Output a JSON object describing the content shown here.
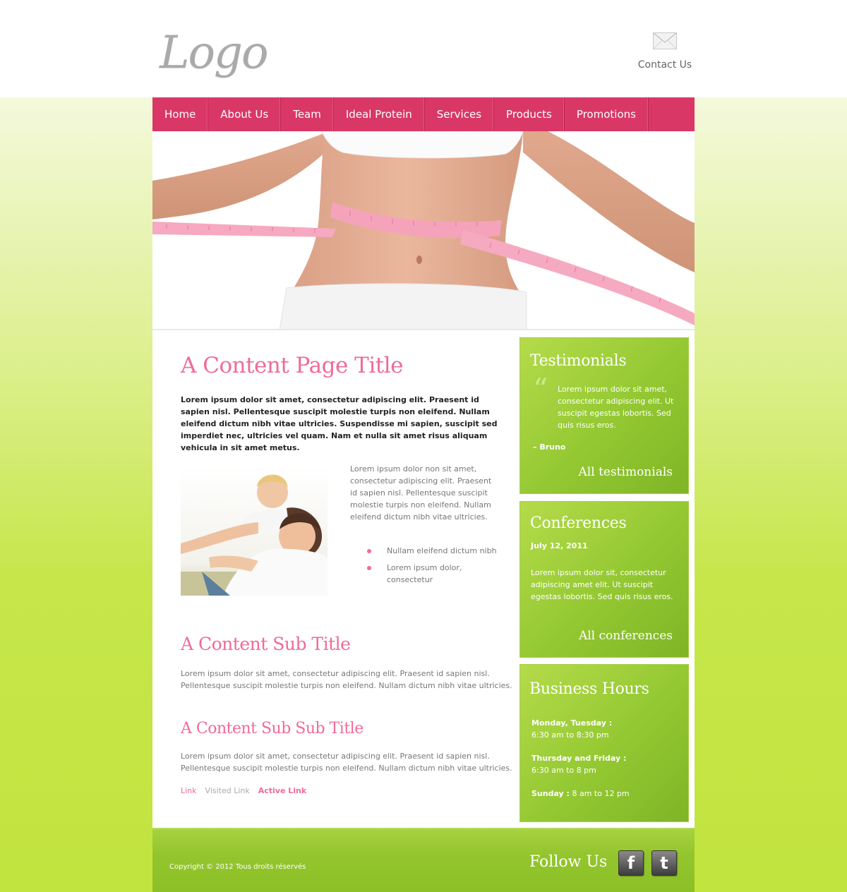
{
  "header": {
    "logo_text": "Logo",
    "contact_label": "Contact Us",
    "envelope_icon": "envelope-icon"
  },
  "nav": {
    "items": [
      {
        "label": "Home"
      },
      {
        "label": "About Us"
      },
      {
        "label": "Team"
      },
      {
        "label": "Ideal Protein"
      },
      {
        "label": "Services"
      },
      {
        "label": "Products"
      },
      {
        "label": "Promotions"
      }
    ]
  },
  "main": {
    "title": "A Content Page Title",
    "intro": "Lorem ipsum dolor sit amet, consectetur adipiscing elit. Praesent id sapien nisl. Pellentesque suscipit molestie turpis non eleifend. Nullam eleifend dictum nibh vitae ultricies. Suspendisse mi sapien, suscipit sed imperdiet nec, ultricies vel quam. Nam et nulla sit amet risus aliquam vehicula in sit amet metus.",
    "side_text": "Lorem ipsum dolor non sit amet, consectetur adipiscing elit. Praesent id sapien nisl. Pellentesque suscipit molestie turpis non eleifend. Nullam eleifend dictum nibh vitae ultricies.",
    "bullets": [
      "Nullam eleifend dictum nibh",
      "Lorem ipsum dolor, consectetur"
    ],
    "sub_title": "A Content Sub Title",
    "sub_text": "Lorem ipsum dolor sit amet, consectetur adipiscing elit. Praesent id sapien nisl. Pellentesque suscipit molestie turpis non eleifend. Nullam dictum nibh vitae ultricies.",
    "subsub_title": "A Content Sub Sub Title",
    "subsub_text": "Lorem ipsum dolor sit amet, consectetur adipiscing elit. Praesent id sapien nisl. Pellentesque suscipit molestie turpis non eleifend. Nullam dictum nibh vitae ultricies.",
    "links": {
      "link": "Link",
      "visited": "Visited Link",
      "active": "Active Link"
    }
  },
  "sidebar": {
    "testimonials": {
      "title": "Testimonials",
      "quote_mark": "“",
      "quote": "Lorem ipsum dolor sit amet, consectetur adipiscing elit. Ut suscipit egestas lobortis. Sed quis risus eros.",
      "author": "– Bruno",
      "more": "All testimonials"
    },
    "conferences": {
      "title": "Conferences",
      "date": "July 12, 2011",
      "text": "Lorem ipsum dolor sit, consectetur adipiscing amet elit. Ut suscipit egestas lobortis. Sed quis risus eros.",
      "more": "All conferences"
    },
    "hours": {
      "title": "Business Hours",
      "rows": [
        {
          "day": "Monday, Tuesday :",
          "time": "6:30 am to 8:30 pm"
        },
        {
          "day": "Thursday and Friday :",
          "time": "6:30 am to 8 pm"
        },
        {
          "day": "Sunday :",
          "time": "8 am to 12 pm"
        }
      ]
    }
  },
  "footer": {
    "copyright": "Copyright © 2012 Tous droits réservés",
    "follow": "Follow Us",
    "facebook_icon": "facebook-icon",
    "twitter_icon": "twitter-icon",
    "facebook_glyph": "f",
    "twitter_glyph": "t"
  },
  "colors": {
    "nav_pink": "#d93866",
    "title_pink": "#f06b96",
    "widget_green": "#93c832",
    "footer_green": "#94c52e"
  }
}
